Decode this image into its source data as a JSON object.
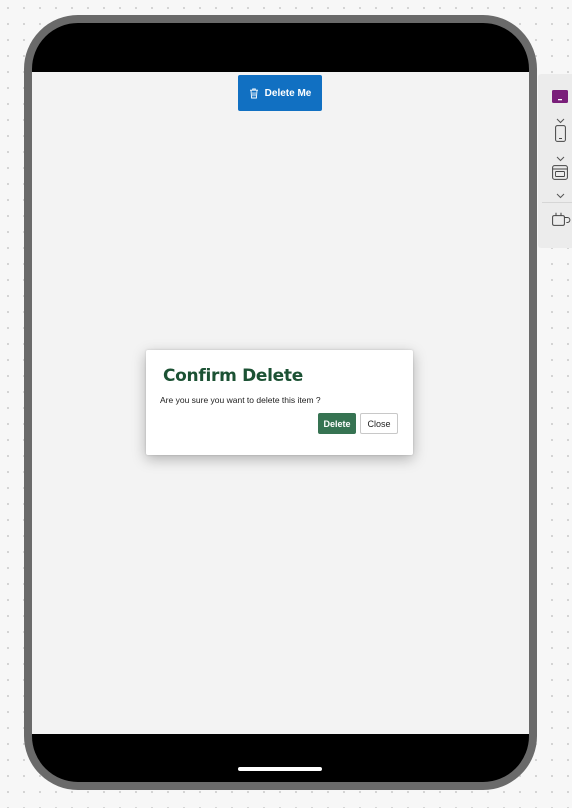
{
  "app": {
    "action_button": {
      "label": "Delete Me",
      "icon": "trash-icon",
      "color": "#1170c2"
    }
  },
  "dialog": {
    "title": "Confirm Delete",
    "message": "Are you sure you want to delete this item ?",
    "confirm_label": "Delete",
    "cancel_label": "Close",
    "title_color": "#1c5234",
    "confirm_color": "#367352"
  },
  "toolbar": {
    "items": [
      {
        "icon": "theme-swatch-icon",
        "accent": "#7a1f7a"
      },
      {
        "icon": "phone-device-icon"
      },
      {
        "icon": "layout-preview-icon"
      },
      {
        "icon": "plug-connector-icon"
      }
    ]
  }
}
